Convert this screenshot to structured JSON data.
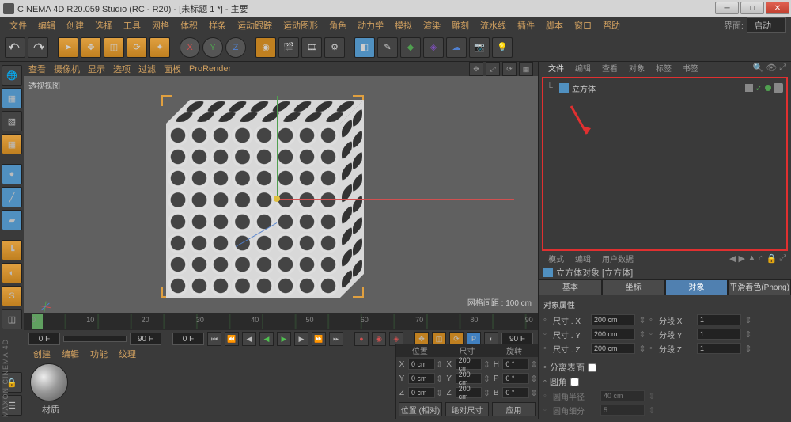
{
  "title": "CINEMA 4D R20.059 Studio (RC - R20) - [未标题 1 *] - 主要",
  "menu": [
    "文件",
    "编辑",
    "创建",
    "选择",
    "工具",
    "网格",
    "体积",
    "样条",
    "运动跟踪",
    "运动图形",
    "角色",
    "动力学",
    "模拟",
    "渲染",
    "雕刻",
    "流水线",
    "插件",
    "脚本",
    "窗口",
    "帮助"
  ],
  "layout_label": "界面:",
  "layout_value": "启动",
  "viewmenu": [
    "查看",
    "摄像机",
    "显示",
    "选项",
    "过滤",
    "面板",
    "ProRender"
  ],
  "viewport_title": "透视视图",
  "grid_info": "网格间距 : 100 cm",
  "ruler_ticks": [
    "0",
    "10",
    "20",
    "30",
    "40",
    "50",
    "60",
    "70",
    "80",
    "90"
  ],
  "time_start": "0 F",
  "time_cur": "0 F",
  "time_end": "90 F",
  "time_end2": "90 F",
  "matmgr_tabs": [
    "创建",
    "编辑",
    "功能",
    "纹理"
  ],
  "mat_name": "材质",
  "coord_headers": [
    "位置",
    "尺寸",
    "旋转"
  ],
  "coord_rows": [
    {
      "l": "X",
      "p": "0 cm",
      "s": "200 cm",
      "r": "0 °",
      "rl": "H"
    },
    {
      "l": "Y",
      "p": "0 cm",
      "s": "200 cm",
      "r": "0 °",
      "rl": "P"
    },
    {
      "l": "Z",
      "p": "0 cm",
      "s": "200 cm",
      "r": "0 °",
      "rl": "B"
    }
  ],
  "coord_btn1": "位置 (相对)",
  "coord_btn2": "绝对尺寸",
  "coord_apply": "应用",
  "right_tabs": [
    "文件",
    "编辑",
    "查看",
    "对象",
    "标签",
    "书签"
  ],
  "obj_name": "立方体",
  "attr_tabs": [
    "模式",
    "编辑",
    "用户数据"
  ],
  "attr_obj_title": "立方体对象 [立方体]",
  "attr_main_tabs": [
    "基本",
    "坐标",
    "对象",
    "平滑着色(Phong)"
  ],
  "attr_section": "对象属性",
  "attr_rows": [
    {
      "l": "尺寸 . X",
      "v": "200 cm",
      "l2": "分段 X",
      "v2": "1"
    },
    {
      "l": "尺寸 . Y",
      "v": "200 cm",
      "l2": "分段 Y",
      "v2": "1"
    },
    {
      "l": "尺寸 . Z",
      "v": "200 cm",
      "l2": "分段 Z",
      "v2": "1"
    }
  ],
  "attr_sep": "分离表面",
  "attr_fillet": "圆角",
  "attr_fillet_r_l": "圆角半径",
  "attr_fillet_r_v": "40 cm",
  "attr_fillet_s_l": "圆角细分",
  "attr_fillet_s_v": "5",
  "logo": "MAXON CINEMA 4D"
}
